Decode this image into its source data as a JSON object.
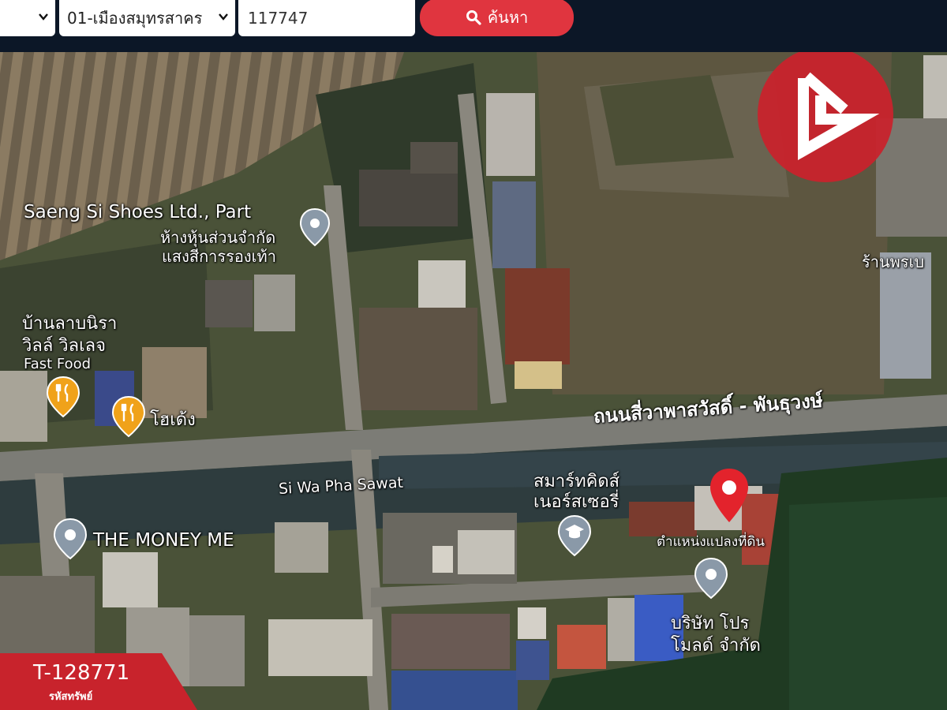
{
  "search": {
    "province_select": "",
    "district_select": "01-เมืองสมุทรสาคร",
    "code_value": "117747",
    "button_label": "ค้นหา"
  },
  "map": {
    "labels": {
      "saeng_si_en": "Saeng Si Shoes Ltd., Part",
      "saeng_si_th1": "ห้างหุ้นส่วนจำกัด",
      "saeng_si_th2": "แสงสีการรองเท้า",
      "baan_line1": "บ้านลาบนิรา",
      "baan_line2": "วิลล์ วิลเลจ",
      "fast_food": "Fast Food",
      "ohdeng": "โฮเด้ง",
      "road_main": "ถนนสี่วาพาสวัสดิ์ - พันธุวงษ์",
      "si_wa": "Si Wa Pha Sawat",
      "smart1": "สมาร์ทคิดส์",
      "smart2": "เนอร์สเซอรี่",
      "money_me": "THE MONEY ME",
      "plot": "ตำแหน่งแปลงที่ดิน",
      "bristh1": "บริษัท โปร",
      "bristh2": "โมลด์ จำกัด",
      "shop_right": "ร้านพรเบ"
    }
  },
  "badge": {
    "code": "T-128771",
    "sub": "รหัสทรัพย์"
  },
  "colors": {
    "topbar": "#0c1727",
    "search_button": "#e0353f",
    "badge": "#c8232c",
    "marker": "#e3232c"
  }
}
